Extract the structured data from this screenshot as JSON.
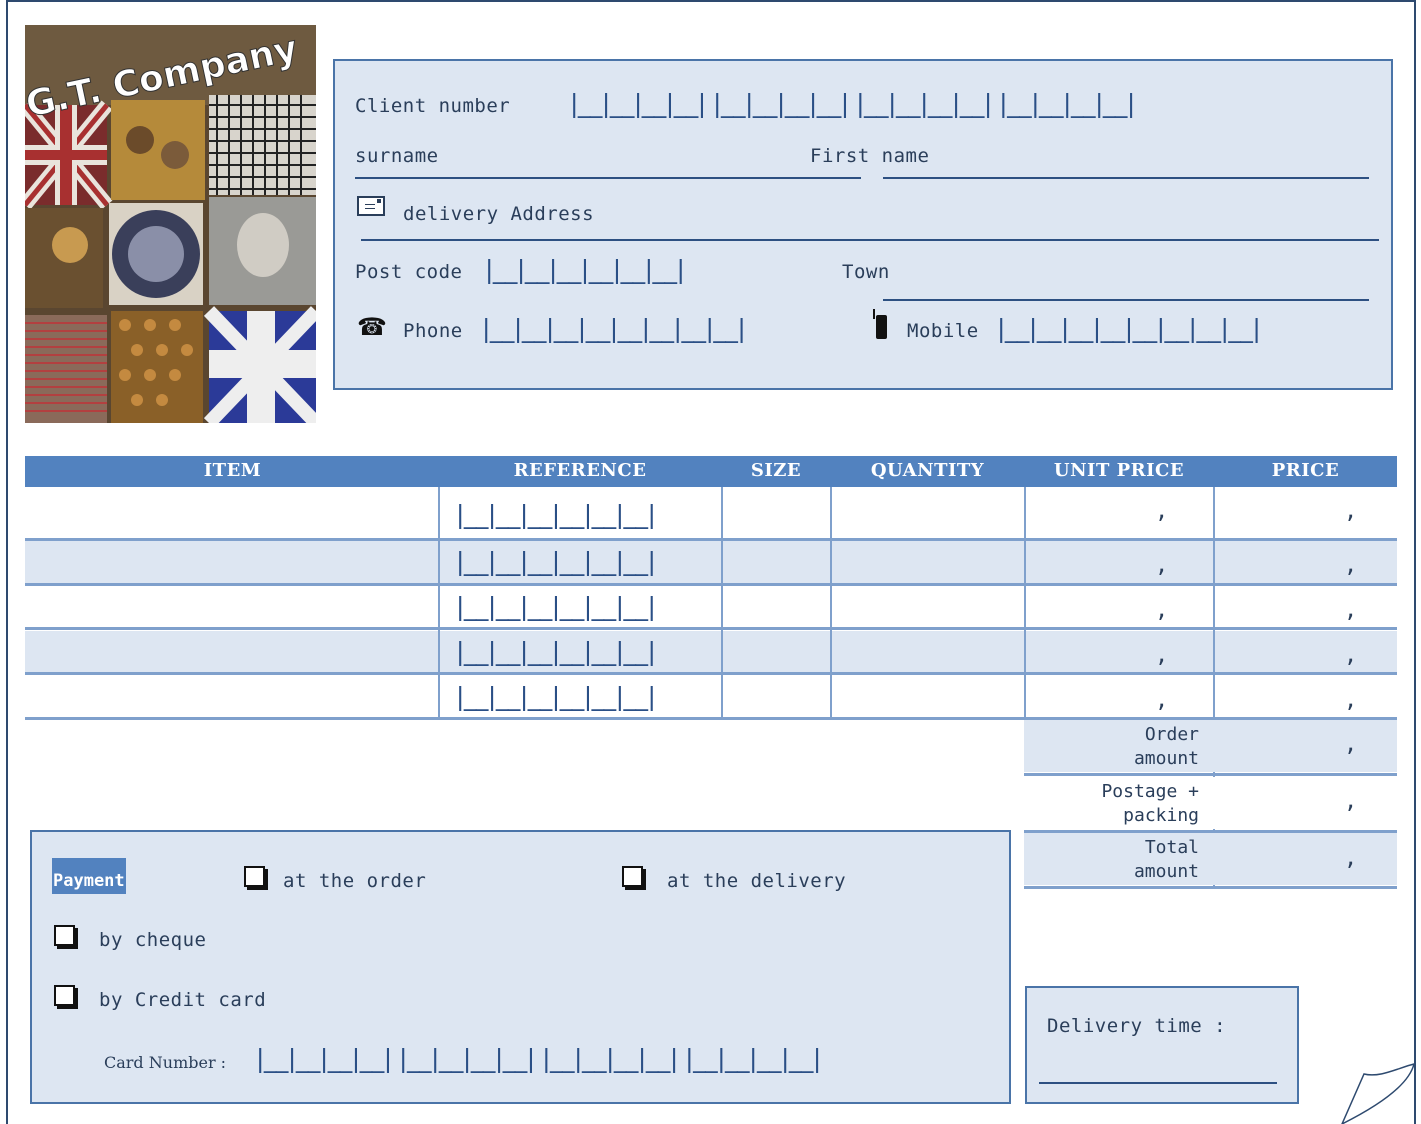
{
  "brand": {
    "name": "G.T. Company"
  },
  "client": {
    "client_number_label": "Client number",
    "client_number_boxes": "|__|__|__|__|  |__|__|__|__|  |__|__|__|__|  |__|__|__|__|",
    "surname_label": "surname",
    "first_name_label": "First name",
    "address_label": "delivery Address",
    "post_code_label": "Post code",
    "post_code_boxes": "|__|__|__|__|__|__|",
    "town_label": "Town",
    "phone_label": "Phone",
    "phone_boxes": "|__|__|__|__|__|__|__|__|",
    "mobile_label": "Mobile",
    "mobile_boxes": "|__|__|__|__|__|__|__|__|"
  },
  "orders": {
    "headers": {
      "item": "ITEM",
      "reference": "REFERENCE",
      "size": "SIZE",
      "quantity": "QUANTITY",
      "unit_price": "UNIT PRICE",
      "price": "PRICE"
    },
    "reference_boxes": "|__|__|__|__|__|__|",
    "comma": ",",
    "rows": 5
  },
  "summary": {
    "order_amount": "Order\namount",
    "postage": "Postage +\npacking",
    "total": "Total\namount"
  },
  "payment": {
    "title": "Payment",
    "at_order": "at the order",
    "at_delivery": "at the delivery",
    "by_cheque": "by cheque",
    "by_card": "by Credit card",
    "card_number_label": "Card Number :",
    "card_number_boxes": "|__|__|__|__|  |__|__|__|__|  |__|__|__|__|  |__|__|__|__|"
  },
  "delivery": {
    "label": "Delivery time :"
  },
  "colors": {
    "header_blue": "#5282bf",
    "panel_fill": "#dde6f2",
    "border_blue": "#4a74a8",
    "text_dark": "#2a3e5a"
  }
}
